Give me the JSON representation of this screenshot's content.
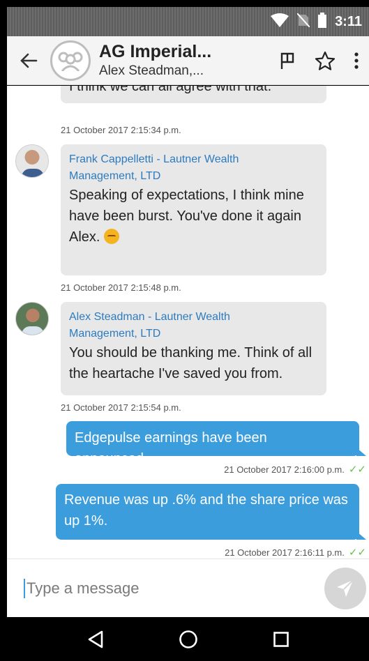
{
  "status_bar": {
    "time": "3:11",
    "icons": [
      "wifi-icon",
      "no-sim-icon",
      "battery-icon"
    ]
  },
  "header": {
    "title": "AG Imperial...",
    "subtitle": "Alex Steadman,...",
    "icons": [
      "back-arrow-icon",
      "group-avatar-icon",
      "flag-icon",
      "star-icon",
      "more-vert-icon"
    ]
  },
  "messages": [
    {
      "type": "incoming-cut",
      "text": "I think we can all agree with that.",
      "timestamp": "21 October 2017 2:15:34 p.m."
    },
    {
      "type": "incoming",
      "sender": "Frank Cappelletti - Lautner Wealth Management, LTD",
      "sender_line1": "Frank Cappelletti - Lautner Wealth",
      "sender_line2": "Management, LTD",
      "text_line1": "Speaking of expectations, I think mine",
      "text_line2": "have been burst. You've done it again",
      "text_line3": "Alex.",
      "emoji": "unamused-face-icon",
      "timestamp": "21 October 2017 2:15:48 p.m."
    },
    {
      "type": "incoming",
      "sender": "Alex Steadman - Lautner Wealth Management, LTD",
      "sender_line1": "Alex Steadman - Lautner Wealth",
      "sender_line2": "Management, LTD",
      "text_line1": "You should be thanking me. Think of all",
      "text_line2": "the heartache I've saved you from.",
      "timestamp": "21 October 2017 2:15:54 p.m."
    },
    {
      "type": "outgoing",
      "text": "Edgepulse earnings have been announced...",
      "timestamp": "21 October 2017 2:16:00 p.m.",
      "status": "read"
    },
    {
      "type": "outgoing",
      "text_line1": "Revenue was up .6% and the share price was",
      "text_line2": "up 1%.",
      "timestamp": "21 October 2017 2:16:11 p.m.",
      "status": "read"
    }
  ],
  "composer": {
    "placeholder": "Type a message",
    "send_icon": "send-icon"
  },
  "nav": [
    "back-triangle-icon",
    "home-circle-icon",
    "recents-square-icon"
  ],
  "colors": {
    "outgoing_bubble": "#3c9ddc",
    "incoming_bubble": "#e8e8e8",
    "sender_name": "#2d7bbf",
    "read_check": "#6bbf4c"
  }
}
